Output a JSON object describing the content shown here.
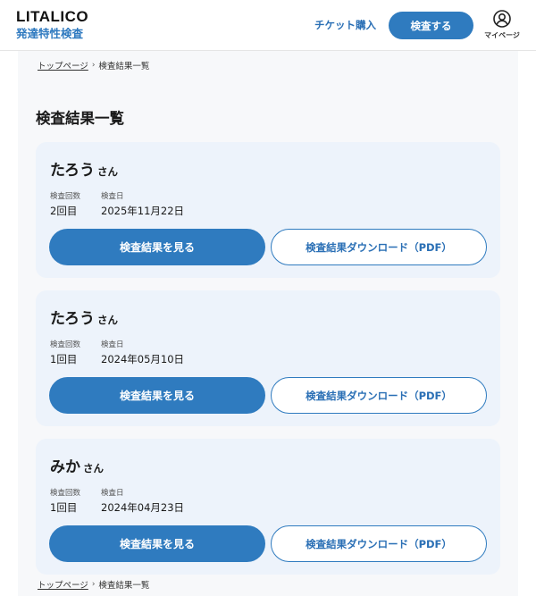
{
  "header": {
    "logo_main": "LITALICO",
    "logo_sub": "発達特性検査",
    "ticket_link": "チケット購入",
    "exam_button": "検査する",
    "mypage_label": "マイページ",
    "mypage_icon": "user-circle-icon"
  },
  "breadcrumb": {
    "home": "トップページ",
    "separator": "›",
    "current": "検査結果一覧"
  },
  "page_title": "検査結果一覧",
  "labels": {
    "count_label": "検査回数",
    "date_label": "検査日",
    "view_button": "検査結果を見る",
    "download_button": "検査結果ダウンロード（PDF）"
  },
  "results": [
    {
      "name": "たろう",
      "suffix": "さん",
      "count": "2回目",
      "date": "2025年11月22日"
    },
    {
      "name": "たろう",
      "suffix": "さん",
      "count": "1回目",
      "date": "2024年05月10日"
    },
    {
      "name": "みか",
      "suffix": "さん",
      "count": "1回目",
      "date": "2024年04月23日"
    }
  ],
  "colors": {
    "accent": "#2f7bbf",
    "card_bg": "#edf3fb",
    "page_bg": "#f7f8fa"
  }
}
